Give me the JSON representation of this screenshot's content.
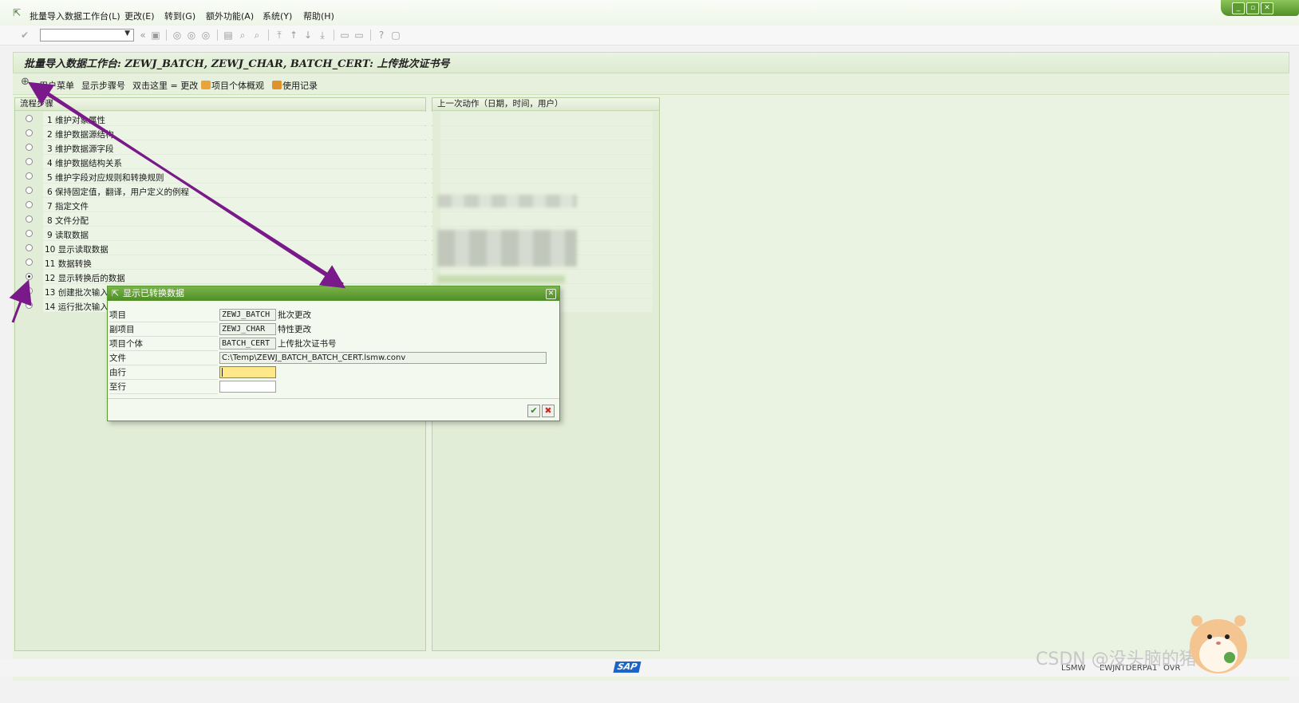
{
  "menubar": {
    "items": [
      "批量导入数据工作台(L)",
      "更改(E)",
      "转到(G)",
      "额外功能(A)",
      "系统(Y)",
      "帮助(H)"
    ]
  },
  "window_controls": {
    "minimize": "_",
    "restore": "▫",
    "close": "✕"
  },
  "page_title": "批量导入数据工作台: ZEWJ_BATCH, ZEWJ_CHAR, BATCH_CERT: 上传批次证书号",
  "app_toolbar": {
    "user_menu": "用户菜单",
    "show_step_no": "显示步骤号",
    "double_click_change": "双击这里 = 更改",
    "object_overview": "项目个体概观",
    "usage_log": "使用记录"
  },
  "steps_panel": {
    "header": "流程步骤",
    "steps": [
      "1 维护对象属性",
      "2 维护数据源结构",
      "3 维护数据源字段",
      "4 维护数据结构关系",
      "5 维护字段对应规则和转换规则",
      "6 保持固定值，翻译，用户定义的例程",
      "7 指定文件",
      "8 文件分配",
      "9 读取数据",
      "10 显示读取数据",
      "11 数据转换",
      "12 显示转换后的数据",
      "13 创建批次输入",
      "14 运行批次输入"
    ],
    "selected_index": 11
  },
  "last_action_panel": {
    "header": "上一次动作（日期，时间，用户）"
  },
  "dialog": {
    "title": "显示已转换数据",
    "labels": [
      "项目",
      "副项目",
      "项目个体",
      "文件",
      "由行",
      "至行"
    ],
    "fields": {
      "project": "ZEWJ_BATCH",
      "subproject": "ZEWJ_CHAR",
      "object": "BATCH_CERT",
      "file": "C:\\Temp\\ZEWJ_BATCH_BATCH_CERT.lsmw.conv",
      "from_line": "",
      "to_line": ""
    },
    "descriptions": {
      "project": "批次更改",
      "subproject": "特性更改",
      "object": "上传批次证书号"
    },
    "ok_icon": "check-icon",
    "cancel_icon": "cancel-icon"
  },
  "statusbar": {
    "sap_logo": "SAP",
    "items": [
      "LSMW",
      "EWJNTDERPA1",
      "OVR"
    ]
  },
  "watermark": "CSDN @没头脑的猪",
  "colors": {
    "sap_green": "#5a9a2f",
    "panel_bg": "#e1edd6",
    "annotation_arrow": "#7a1a8a",
    "input_required": "#ffe88a"
  }
}
